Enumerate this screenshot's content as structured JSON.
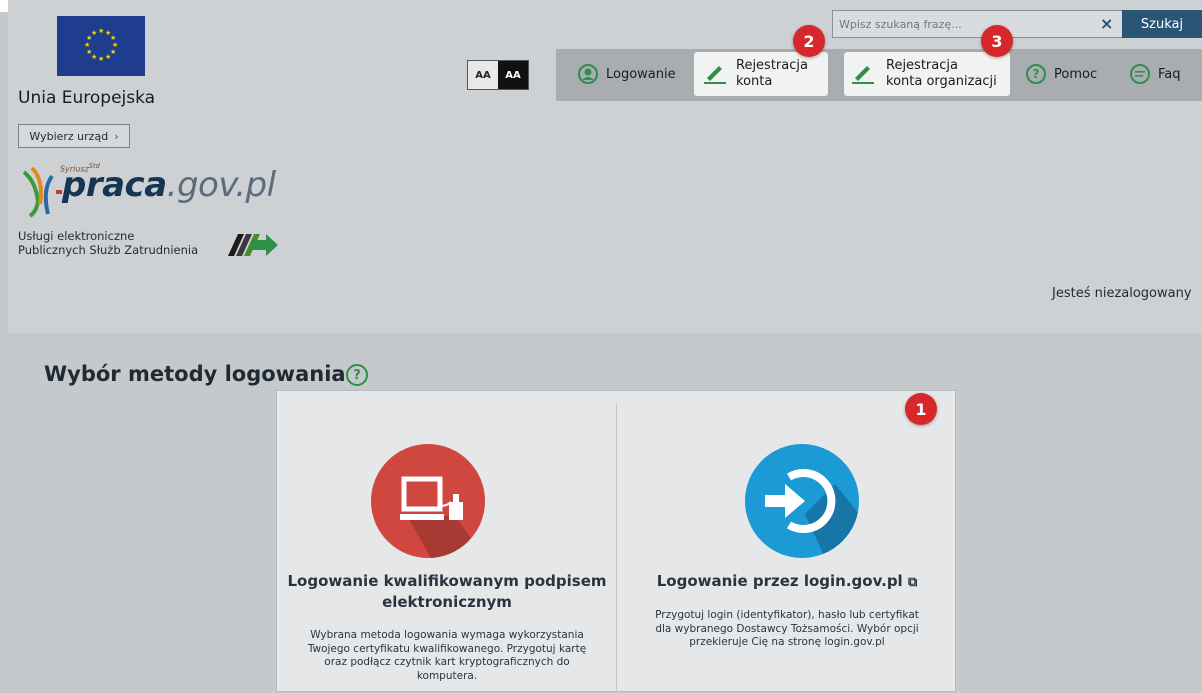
{
  "header": {
    "eu_label": "Unia Europejska",
    "office_button": "Wybierz urząd",
    "logo": {
      "superscript": "Syriusz",
      "superscript_std": "Std",
      "brand_main": "praca",
      "brand_domain": ".gov.pl"
    },
    "services_line1": "Usługi elektroniczne",
    "services_line2": "Publicznych Służb Zatrudnienia",
    "font_size_normal": "AA",
    "font_size_contrast": "AA",
    "status": "Jesteś niezalogowany"
  },
  "search": {
    "placeholder": "Wpisz szukaną frazę...",
    "clear": "×",
    "button": "Szukaj"
  },
  "nav": {
    "login": "Logowanie",
    "register_line1": "Rejestracja",
    "register_line2": "konta",
    "register_org_line1": "Rejestracja",
    "register_org_line2": "konta organizacji",
    "help": "Pomoc",
    "faq": "Faq"
  },
  "badges": {
    "one": "1",
    "two": "2",
    "three": "3"
  },
  "main": {
    "title": "Wybór metody logowania",
    "help_glyph": "?",
    "options": [
      {
        "title_line1": "Logowanie kwalifikowanym podpisem",
        "title_line2": "elektronicznym",
        "desc": [
          "Wybrana metoda logowania wymaga wykorzystania",
          "Twojego certyfikatu kwalifikowanego. Przygotuj kartę",
          "oraz podłącz czytnik kart kryptograficznych do",
          "komputera."
        ],
        "icon": "computer-card-reader-icon",
        "icon_color": "#d0473f"
      },
      {
        "title_line1": "Logowanie przez login.gov.pl",
        "ext_glyph": "⧉",
        "desc": [
          "Przygotuj login (identyfikator), hasło lub certyfikat",
          "dla wybranego Dostawcy Tożsamości. Wybór opcji",
          "przekieruje Cię na stronę login.gov.pl"
        ],
        "icon": "login-arrow-icon",
        "icon_color": "#1c9ad6"
      }
    ]
  },
  "colors": {
    "accent_green": "#2f8f47",
    "search_button": "#2b5574",
    "badge_red": "#d6282b"
  }
}
